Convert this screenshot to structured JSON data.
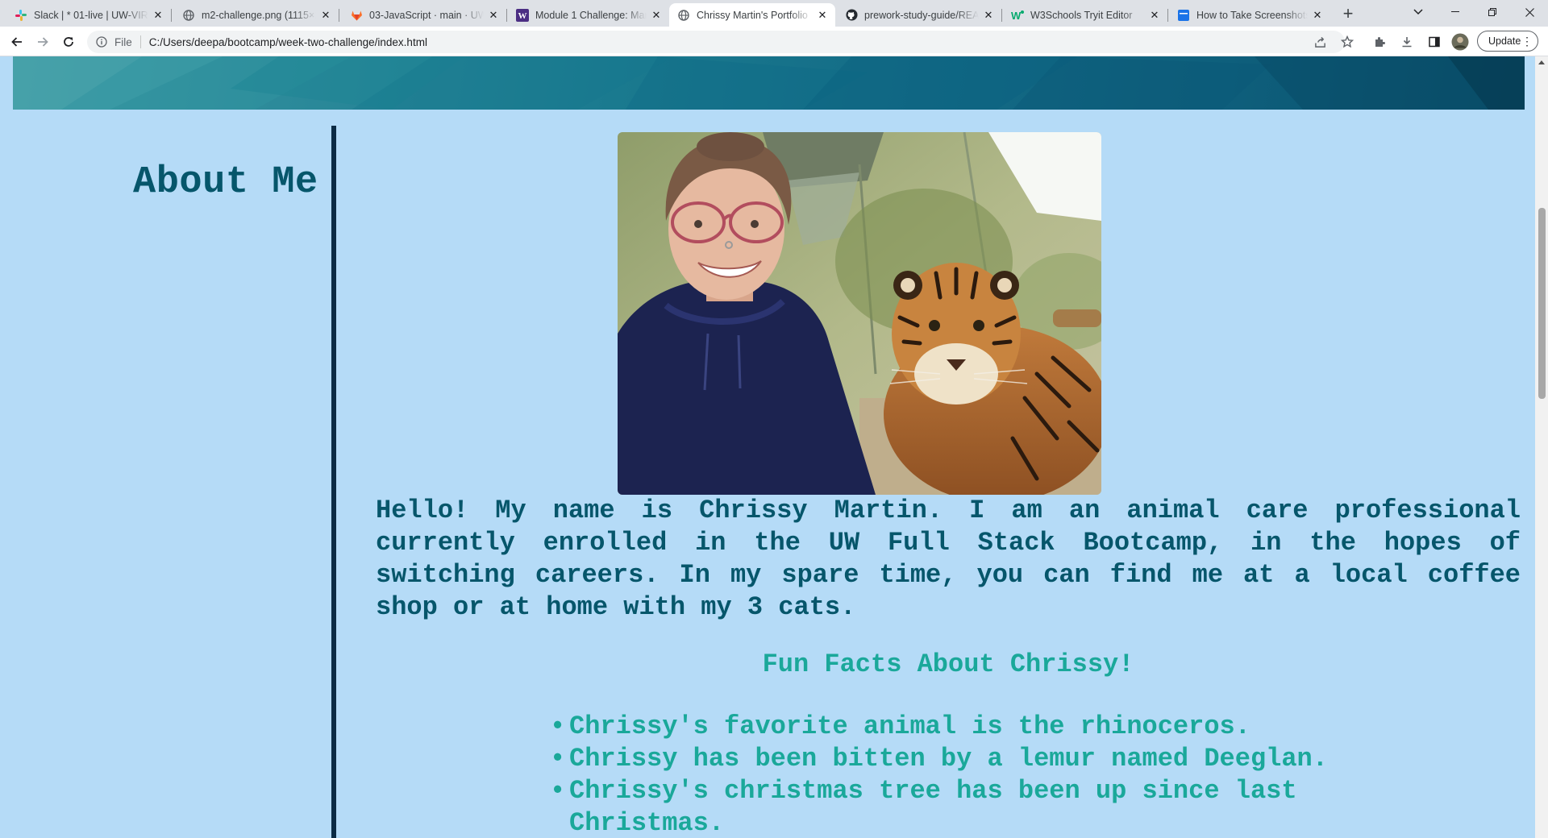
{
  "browser": {
    "tabs": [
      {
        "title": "Slack | * 01-live | UW-VIRT",
        "icon": "slack-icon",
        "active": false
      },
      {
        "title": "m2-challenge.png (1115×1",
        "icon": "globe-icon",
        "active": false
      },
      {
        "title": "03-JavaScript · main · UWA",
        "icon": "gitlab-icon",
        "active": false
      },
      {
        "title": "Module 1 Challenge: Martin",
        "icon": "uw-icon",
        "active": false
      },
      {
        "title": "Chrissy Martin's Portfolio",
        "icon": "globe-icon",
        "active": true
      },
      {
        "title": "prework-study-guide/REAL",
        "icon": "github-icon",
        "active": false
      },
      {
        "title": "W3Schools Tryit Editor",
        "icon": "w3schools-icon",
        "active": false
      },
      {
        "title": "How to Take Screenshots o",
        "icon": "doc-icon",
        "active": false
      }
    ],
    "address": {
      "scheme": "File",
      "url": "C:/Users/deepa/bootcamp/week-two-challenge/index.html"
    },
    "update_label": "Update",
    "colors": {
      "chrome": "#dee1e6",
      "active_tab": "#ffffff"
    }
  },
  "page": {
    "sidebar_title": "About Me",
    "photo_alt": "Selfie of Chrissy with a tiger",
    "bio": "Hello! My name is Chrissy Martin. I am an animal care professional currently enrolled in the UW Full Stack Bootcamp, in the hopes of switching careers. In my spare time, you can find me at a local coffee shop or at home with my 3 cats.",
    "facts_heading": "Fun Facts About Chrissy!",
    "facts": [
      "Chrissy's favorite animal is the rhinoceros.",
      "Chrissy has been bitten by a lemur named Deeglan.",
      "Chrissy's christmas tree has been up since last Christmas."
    ],
    "colors": {
      "background": "#b5dbf7",
      "primary_text": "#06566b",
      "accent_text": "#1aa89a",
      "divider": "#0b2b44"
    }
  }
}
